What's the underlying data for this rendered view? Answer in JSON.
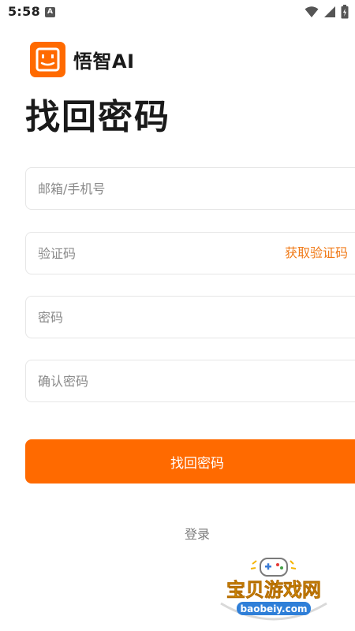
{
  "status_bar": {
    "time": "5:58",
    "notification_icon_letter": "A"
  },
  "app": {
    "name": "悟智AI",
    "brand_color": "#ff6a00",
    "accent_text_color": "#f07a17"
  },
  "page": {
    "title": "找回密码"
  },
  "form": {
    "account_placeholder": "邮箱/手机号",
    "code_placeholder": "验证码",
    "get_code_label": "获取验证码",
    "password_placeholder": "密码",
    "confirm_password_placeholder": "确认密码",
    "submit_label": "找回密码"
  },
  "footer": {
    "login_link": "登录"
  },
  "watermark": {
    "title": "宝贝游戏网",
    "url": "baobeiy.com"
  }
}
